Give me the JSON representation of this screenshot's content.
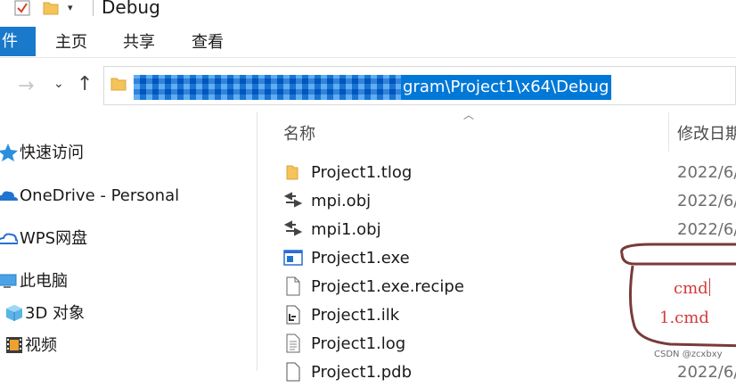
{
  "window": {
    "title": "Debug"
  },
  "ribbon": {
    "tabs": [
      {
        "label": "件"
      },
      {
        "label": "主页"
      },
      {
        "label": "共享"
      },
      {
        "label": "查看"
      }
    ]
  },
  "address_bar": {
    "path_visible": "gram\\Project1\\x64\\Debug"
  },
  "nav_pane": {
    "items": [
      {
        "label": "快速访问",
        "icon": "star-icon"
      },
      {
        "label": "OneDrive - Personal",
        "icon": "cloud-icon"
      },
      {
        "label": "WPS网盘",
        "icon": "cloud-outline-icon"
      },
      {
        "label": "此电脑",
        "icon": "computer-icon"
      },
      {
        "label": "3D 对象",
        "icon": "cube-icon"
      },
      {
        "label": "视频",
        "icon": "film-icon"
      }
    ]
  },
  "file_list": {
    "columns": {
      "name": "名称",
      "date": "修改日期"
    },
    "rows": [
      {
        "name": "Project1.tlog",
        "date": "2022/6/",
        "icon": "folder-icon"
      },
      {
        "name": "mpi.obj",
        "date": "2022/6/",
        "icon": "object-file-icon"
      },
      {
        "name": "mpi1.obj",
        "date": "2022/6/",
        "icon": "object-file-icon"
      },
      {
        "name": "Project1.exe",
        "date": "",
        "icon": "exe-icon"
      },
      {
        "name": "Project1.exe.recipe",
        "date": "",
        "icon": "document-icon"
      },
      {
        "name": "Project1.ilk",
        "date": "",
        "icon": "ilk-file-icon"
      },
      {
        "name": "Project1.log",
        "date": "",
        "icon": "text-file-icon"
      },
      {
        "name": "Project1.pdb",
        "date": "2022/6/",
        "icon": "pdb-file-icon"
      }
    ]
  },
  "annotation": {
    "line1": "cmd",
    "line2": "1.cmd"
  },
  "watermark": "CSDN @zcxbxy",
  "colors": {
    "file_tab": "#1979ca",
    "selection": "#0078d7",
    "annotation": "#d23b3b"
  }
}
